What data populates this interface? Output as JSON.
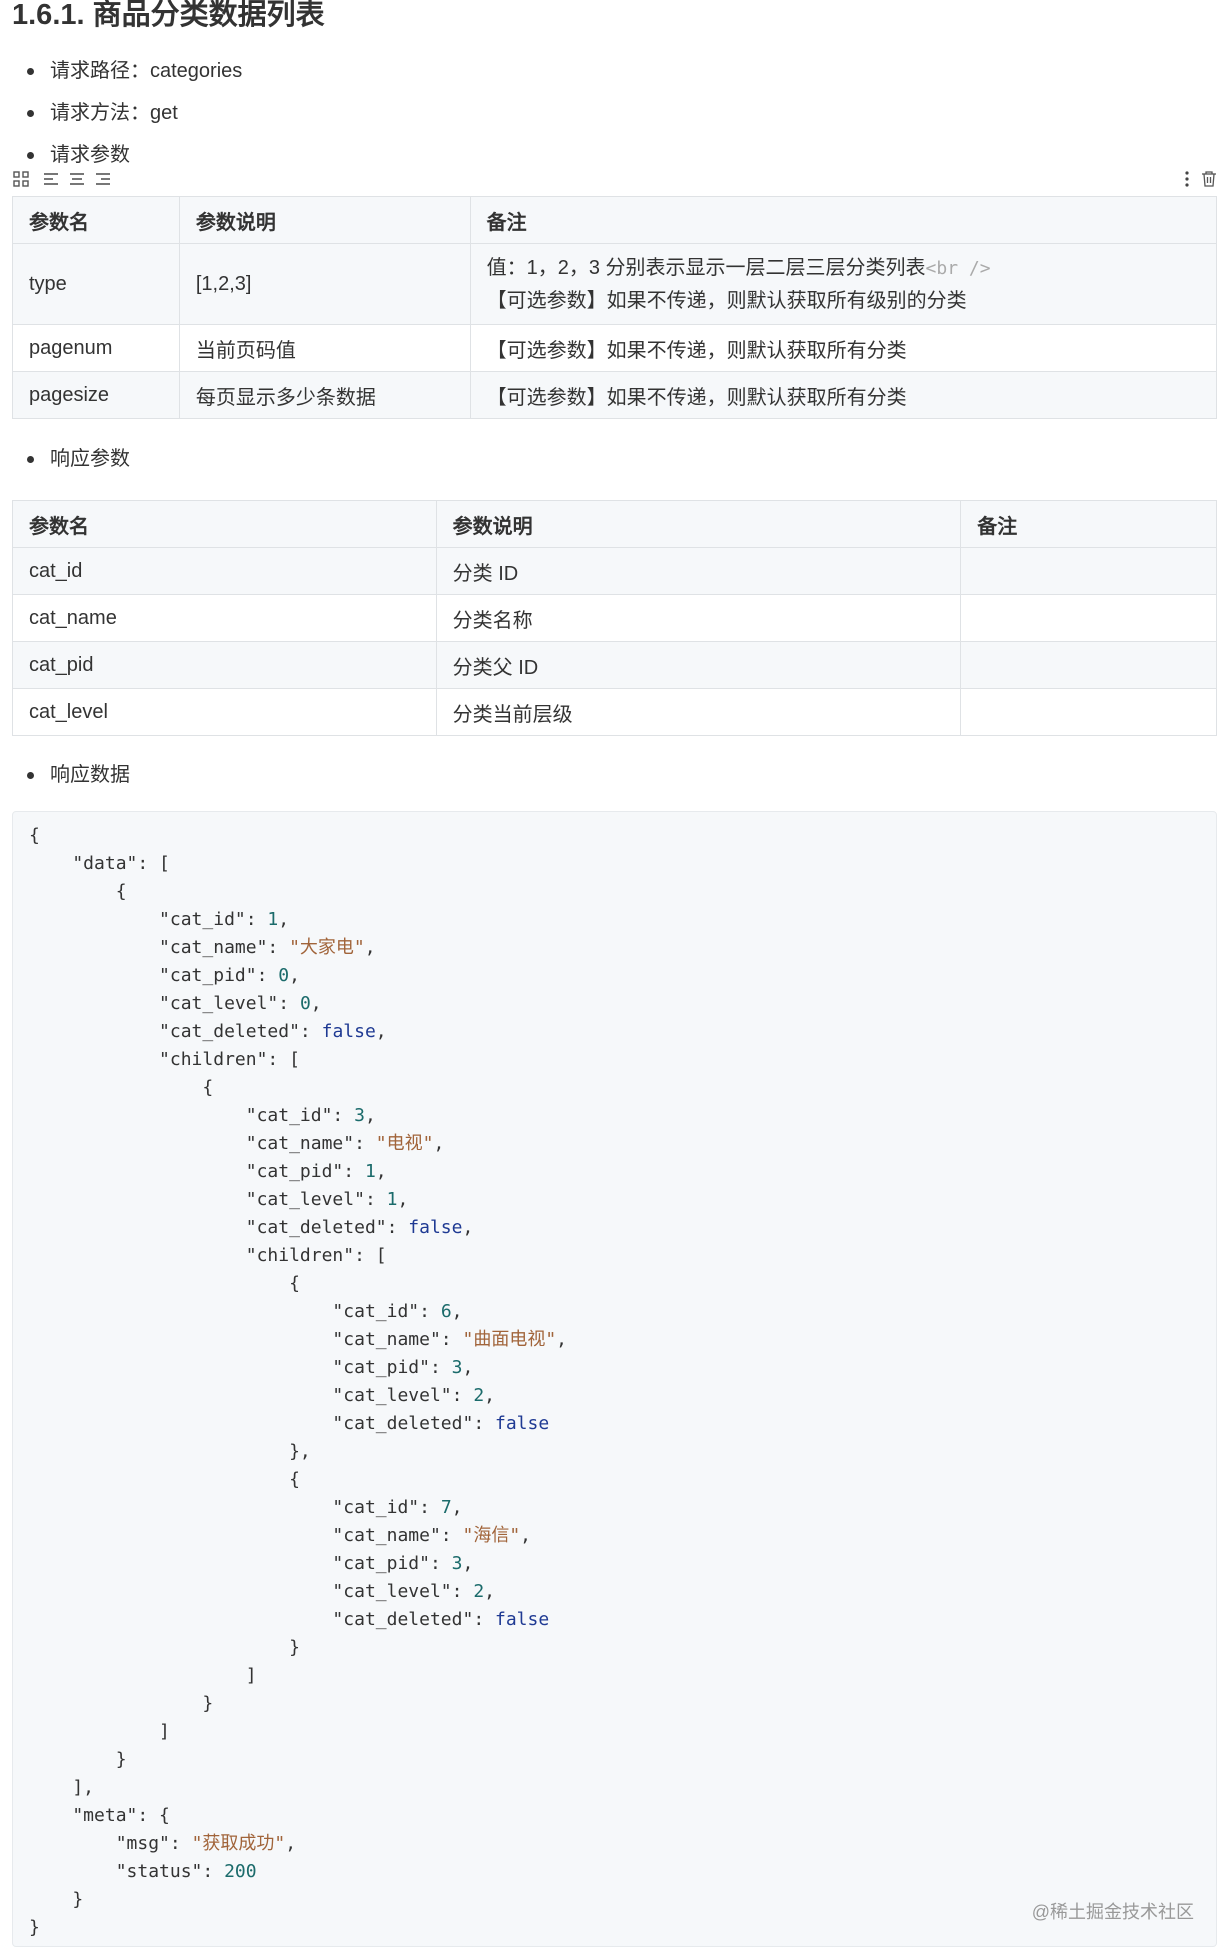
{
  "heading": "1.6.1. 商品分类数据列表",
  "bullets": {
    "path": "请求路径：categories",
    "method": "请求方法：get",
    "params": "请求参数",
    "response_params": "响应参数",
    "response_data": "响应数据"
  },
  "request_table": {
    "headers": [
      "参数名",
      "参数说明",
      "备注"
    ],
    "rows": [
      {
        "name": "type",
        "desc": "[1,2,3]",
        "note1": "值：1，2，3 分别表示显示一层二层三层分类列表",
        "br": "<br />",
        "note2": "【可选参数】如果不传递，则默认获取所有级别的分类"
      },
      {
        "name": "pagenum",
        "desc": "当前页码值",
        "note1": "【可选参数】如果不传递，则默认获取所有分类"
      },
      {
        "name": "pagesize",
        "desc": "每页显示多少条数据",
        "note1": "【可选参数】如果不传递，则默认获取所有分类"
      }
    ]
  },
  "response_table": {
    "headers": [
      "参数名",
      "参数说明",
      "备注"
    ],
    "rows": [
      {
        "name": "cat_id",
        "desc": "分类 ID",
        "note": ""
      },
      {
        "name": "cat_name",
        "desc": "分类名称",
        "note": ""
      },
      {
        "name": "cat_pid",
        "desc": "分类父 ID",
        "note": ""
      },
      {
        "name": "cat_level",
        "desc": "分类当前层级",
        "note": ""
      }
    ]
  },
  "code": {
    "lines": [
      [
        [
          "k",
          "{"
        ]
      ],
      [
        [
          "k",
          "    \"data\": ["
        ]
      ],
      [
        [
          "k",
          "        {"
        ]
      ],
      [
        [
          "k",
          "            \"cat_id\": "
        ],
        [
          "n",
          "1"
        ],
        [
          "k",
          ","
        ]
      ],
      [
        [
          "k",
          "            \"cat_name\": "
        ],
        [
          "s",
          "\"大家电\""
        ],
        [
          "k",
          ","
        ]
      ],
      [
        [
          "k",
          "            \"cat_pid\": "
        ],
        [
          "n",
          "0"
        ],
        [
          "k",
          ","
        ]
      ],
      [
        [
          "k",
          "            \"cat_level\": "
        ],
        [
          "n",
          "0"
        ],
        [
          "k",
          ","
        ]
      ],
      [
        [
          "k",
          "            \"cat_deleted\": "
        ],
        [
          "b",
          "false"
        ],
        [
          "k",
          ","
        ]
      ],
      [
        [
          "k",
          "            \"children\": ["
        ]
      ],
      [
        [
          "k",
          "                {"
        ]
      ],
      [
        [
          "k",
          "                    \"cat_id\": "
        ],
        [
          "n",
          "3"
        ],
        [
          "k",
          ","
        ]
      ],
      [
        [
          "k",
          "                    \"cat_name\": "
        ],
        [
          "s",
          "\"电视\""
        ],
        [
          "k",
          ","
        ]
      ],
      [
        [
          "k",
          "                    \"cat_pid\": "
        ],
        [
          "n",
          "1"
        ],
        [
          "k",
          ","
        ]
      ],
      [
        [
          "k",
          "                    \"cat_level\": "
        ],
        [
          "n",
          "1"
        ],
        [
          "k",
          ","
        ]
      ],
      [
        [
          "k",
          "                    \"cat_deleted\": "
        ],
        [
          "b",
          "false"
        ],
        [
          "k",
          ","
        ]
      ],
      [
        [
          "k",
          "                    \"children\": ["
        ]
      ],
      [
        [
          "k",
          "                        {"
        ]
      ],
      [
        [
          "k",
          "                            \"cat_id\": "
        ],
        [
          "n",
          "6"
        ],
        [
          "k",
          ","
        ]
      ],
      [
        [
          "k",
          "                            \"cat_name\": "
        ],
        [
          "s",
          "\"曲面电视\""
        ],
        [
          "k",
          ","
        ]
      ],
      [
        [
          "k",
          "                            \"cat_pid\": "
        ],
        [
          "n",
          "3"
        ],
        [
          "k",
          ","
        ]
      ],
      [
        [
          "k",
          "                            \"cat_level\": "
        ],
        [
          "n",
          "2"
        ],
        [
          "k",
          ","
        ]
      ],
      [
        [
          "k",
          "                            \"cat_deleted\": "
        ],
        [
          "b",
          "false"
        ]
      ],
      [
        [
          "k",
          "                        },"
        ]
      ],
      [
        [
          "k",
          "                        {"
        ]
      ],
      [
        [
          "k",
          "                            \"cat_id\": "
        ],
        [
          "n",
          "7"
        ],
        [
          "k",
          ","
        ]
      ],
      [
        [
          "k",
          "                            \"cat_name\": "
        ],
        [
          "s",
          "\"海信\""
        ],
        [
          "k",
          ","
        ]
      ],
      [
        [
          "k",
          "                            \"cat_pid\": "
        ],
        [
          "n",
          "3"
        ],
        [
          "k",
          ","
        ]
      ],
      [
        [
          "k",
          "                            \"cat_level\": "
        ],
        [
          "n",
          "2"
        ],
        [
          "k",
          ","
        ]
      ],
      [
        [
          "k",
          "                            \"cat_deleted\": "
        ],
        [
          "b",
          "false"
        ]
      ],
      [
        [
          "k",
          "                        }"
        ]
      ],
      [
        [
          "k",
          "                    ]"
        ]
      ],
      [
        [
          "k",
          "                }"
        ]
      ],
      [
        [
          "k",
          "            ]"
        ]
      ],
      [
        [
          "k",
          "        }"
        ]
      ],
      [
        [
          "k",
          "    ],"
        ]
      ],
      [
        [
          "k",
          "    \"meta\": {"
        ]
      ],
      [
        [
          "k",
          "        \"msg\": "
        ],
        [
          "s",
          "\"获取成功\""
        ],
        [
          "k",
          ","
        ]
      ],
      [
        [
          "k",
          "        \"status\": "
        ],
        [
          "n",
          "200"
        ]
      ],
      [
        [
          "k",
          "    }"
        ]
      ],
      [
        [
          "k",
          "}"
        ]
      ]
    ]
  },
  "watermark": "@稀土掘金技术社区",
  "icons": [
    "grid-icon",
    "align-left-icon",
    "align-center-icon",
    "align-right-icon",
    "more-vertical-icon",
    "trash-icon"
  ]
}
